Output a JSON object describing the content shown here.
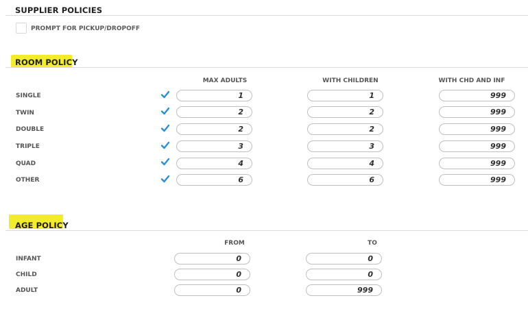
{
  "supplier_policies": {
    "title": "SUPPLIER POLICIES",
    "prompt_label": "PROMPT FOR PICKUP/DROPOFF",
    "prompt_checked": false
  },
  "room_policy": {
    "title": "ROOM POLICY",
    "columns": [
      "MAX ADULTS",
      "WITH CHILDREN",
      "WITH CHD AND INF"
    ],
    "rows": [
      {
        "label": "SINGLE",
        "checked": true,
        "max_adults": "1",
        "with_children": "1",
        "with_chd_inf": "999"
      },
      {
        "label": "TWIN",
        "checked": true,
        "max_adults": "2",
        "with_children": "2",
        "with_chd_inf": "999"
      },
      {
        "label": "DOUBLE",
        "checked": true,
        "max_adults": "2",
        "with_children": "2",
        "with_chd_inf": "999"
      },
      {
        "label": "TRIPLE",
        "checked": true,
        "max_adults": "3",
        "with_children": "3",
        "with_chd_inf": "999"
      },
      {
        "label": "QUAD",
        "checked": true,
        "max_adults": "4",
        "with_children": "4",
        "with_chd_inf": "999"
      },
      {
        "label": "OTHER",
        "checked": true,
        "max_adults": "6",
        "with_children": "6",
        "with_chd_inf": "999"
      }
    ]
  },
  "age_policy": {
    "title": "AGE POLICY",
    "columns": [
      "FROM",
      "TO"
    ],
    "rows": [
      {
        "label": "INFANT",
        "from": "0",
        "to": "0"
      },
      {
        "label": "CHILD",
        "from": "0",
        "to": "0"
      },
      {
        "label": "ADULT",
        "from": "0",
        "to": "999"
      }
    ]
  },
  "colors": {
    "highlight": "#f2ec2a",
    "check": "#2a8fd6",
    "field_border": "#bfbfbf"
  }
}
